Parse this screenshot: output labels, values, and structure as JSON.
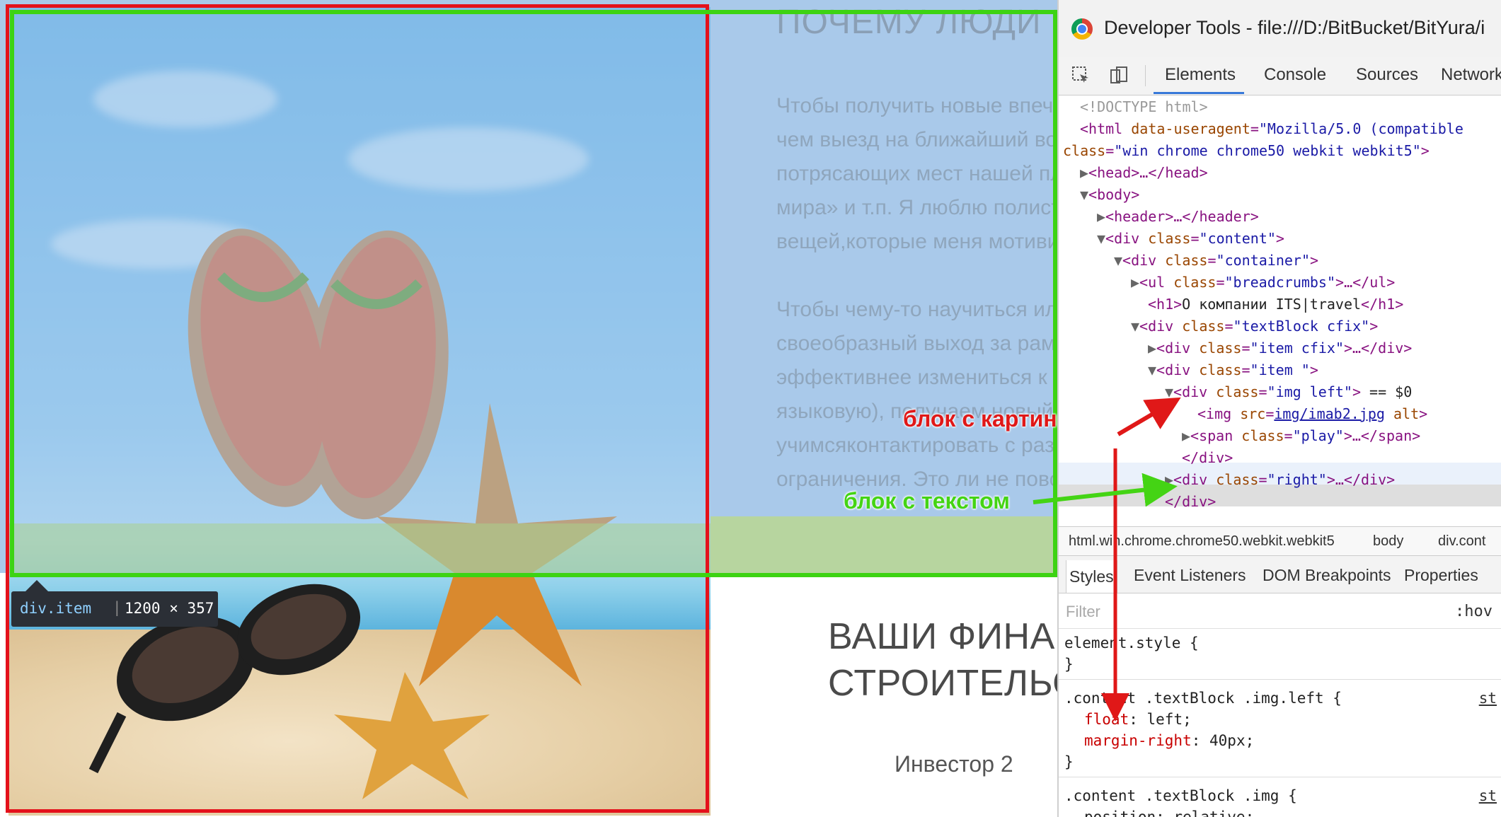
{
  "page": {
    "heading_top": "ПОЧЕМУ ЛЮДИ ЕЗ",
    "paragraph1": [
      "Чтобы получить новые впечат",
      "чем выезд на ближайший вод",
      "потрясающих мест нашей пла",
      "мира» и т.п. Я люблю полистат",
      "вещей,которые меня мотивиру"
    ],
    "paragraph2": [
      "Чтобы чему-то научиться или",
      "своеобразный выход за рамк",
      "эффективнее измениться к лу",
      "языковую), получаем новый о",
      "учимсяконтактировать с разны",
      "ограничения. Это ли не повод"
    ],
    "fin_heading": [
      "ВАШИ ФИНАН",
      "СТРОИТЕЛЬСТВ"
    ],
    "investor": "Инвестор 2"
  },
  "tooltip": {
    "selector": "div.item",
    "size": "1200 × 357"
  },
  "annotations": {
    "image_block": "блок с картинкой",
    "text_block": "блок с текстом"
  },
  "devtools": {
    "title": "Developer Tools - file:///D:/BitBucket/BitYura/i",
    "tabs": [
      "Elements",
      "Console",
      "Sources",
      "Network"
    ],
    "dom": {
      "doctype": "<!DOCTYPE html>",
      "html_open": "<html",
      "html_attr1": "data-useragent",
      "html_val1": "\"Mozilla/5.0 (compatible",
      "html_attr2": "class",
      "html_val2": "\"win chrome chrome50 webkit webkit5\"",
      "head": "<head>…</head>",
      "body": "<body>",
      "header": "<header>…</header>",
      "div_content": "\"content\"",
      "div_container": "\"container\"",
      "ul_breadcrumbs": "\"breadcrumbs\"",
      "h1_text": "О компании ITS|travel",
      "div_textblock": "\"textBlock cfix\"",
      "div_item_cfix": "\"item cfix\"",
      "div_item": "\"item \"",
      "div_img_left": "\"img left\"",
      "eq_marker": "== $0",
      "img_src": "img/imab2.jpg",
      "span_play": "\"play\"",
      "div_right": "\"right\""
    },
    "breadcrumbs": [
      "html.win.chrome.chrome50.webkit.webkit5",
      "body",
      "div.cont"
    ],
    "styles_tabs": [
      "Styles",
      "Event Listeners",
      "DOM Breakpoints",
      "Properties"
    ],
    "filter_placeholder": "Filter",
    "hov": ":hov",
    "rules": {
      "element_style": "element.style {",
      "close": "}",
      "rule2_selector": ".content .textBlock .img.left {",
      "rule2_prop1": "float",
      "rule2_val1": "left;",
      "rule2_prop2": "margin-right",
      "rule2_val2": "40px;",
      "rule3_selector": ".content .textBlock .img {",
      "rule3_partial": "position: relative;",
      "src_link": "st"
    }
  },
  "colors": {
    "highlight_red": "#e4111b",
    "highlight_green": "#3dd313",
    "selection_blue": "#a9c9ea"
  }
}
